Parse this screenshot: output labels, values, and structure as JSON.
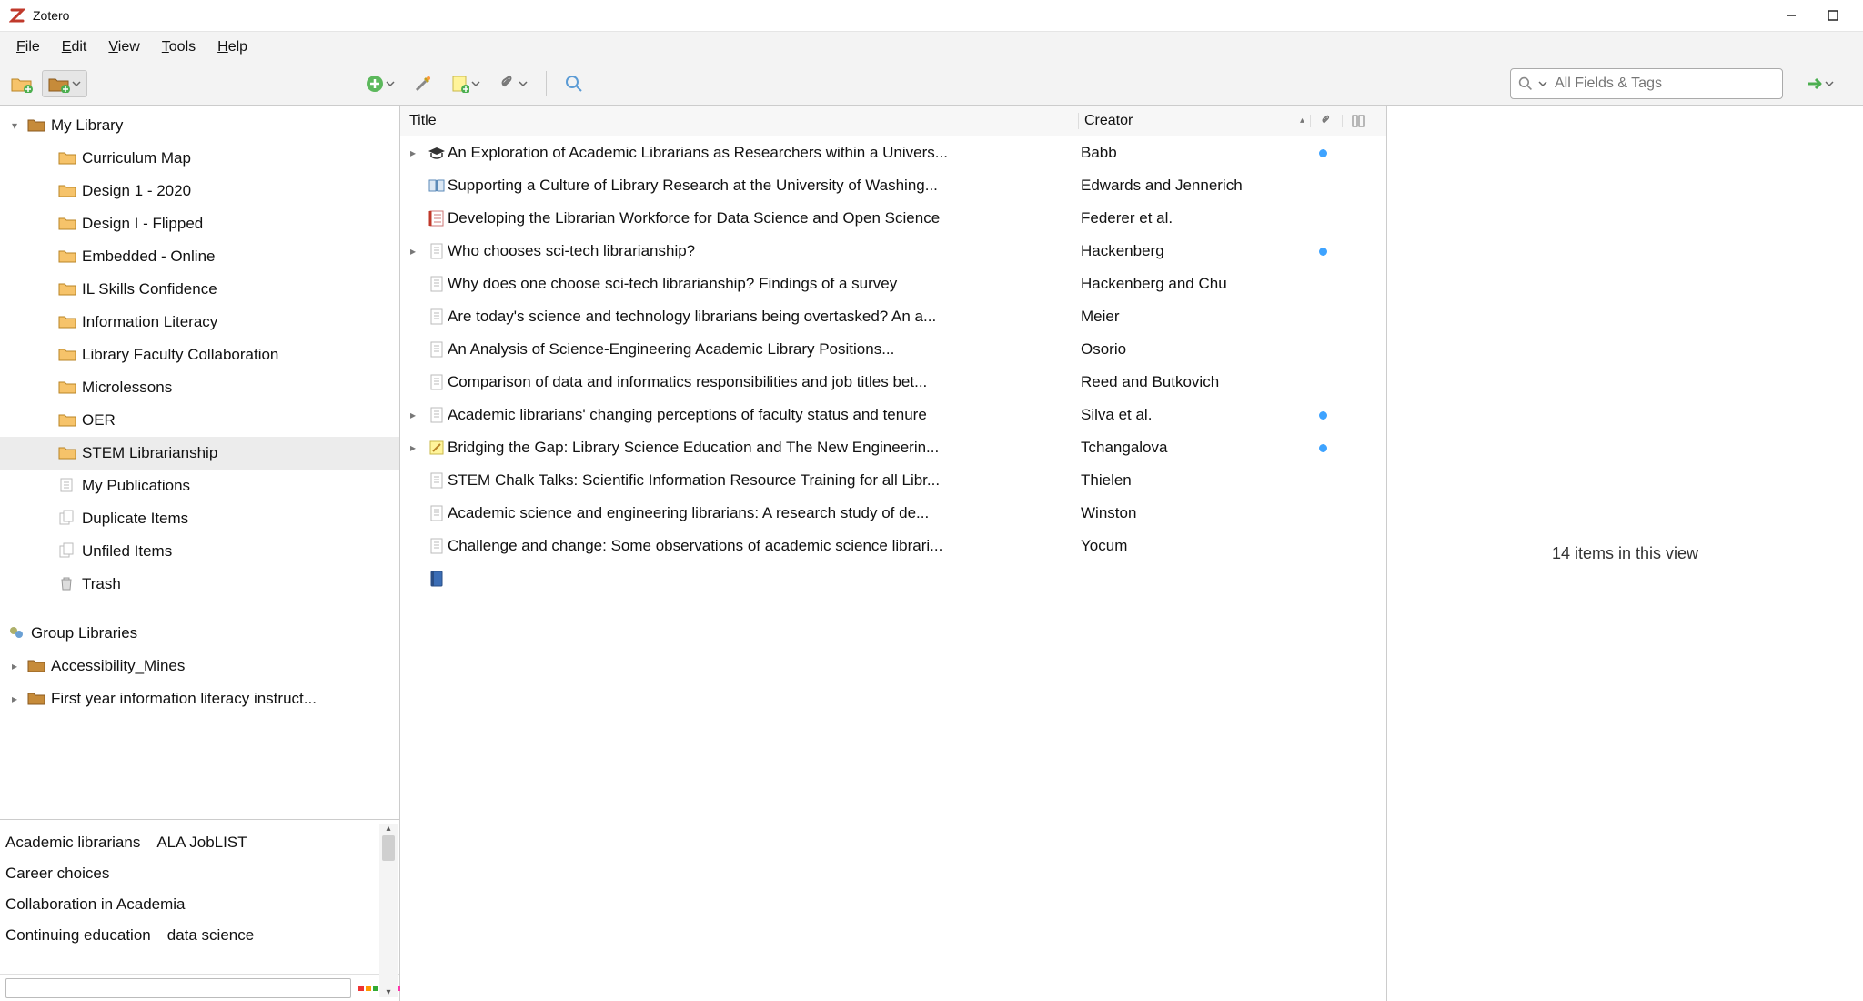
{
  "app": {
    "title": "Zotero"
  },
  "menu": {
    "file": "File",
    "edit": "Edit",
    "view": "View",
    "tools": "Tools",
    "help": "Help"
  },
  "search": {
    "placeholder": "All Fields & Tags"
  },
  "sidebar": {
    "my_library": "My Library",
    "collections": [
      "Curriculum Map",
      "Design 1 - 2020",
      "Design I - Flipped",
      "Embedded - Online",
      "IL Skills Confidence",
      "Information Literacy",
      "Library Faculty Collaboration",
      "Microlessons",
      "OER",
      "STEM Librarianship"
    ],
    "selected_index": 9,
    "my_publications": "My Publications",
    "duplicate": "Duplicate Items",
    "unfiled": "Unfiled Items",
    "trash": "Trash",
    "group_libraries": "Group Libraries",
    "groups": [
      "Accessibility_Mines",
      "First year information literacy instruct..."
    ]
  },
  "tags": [
    "Academic librarians",
    "ALA JobLIST",
    "Career choices",
    "Collaboration in Academia",
    "Continuing education",
    "data science"
  ],
  "columns": {
    "title": "Title",
    "creator": "Creator"
  },
  "items": [
    {
      "expand": true,
      "icon": "grad",
      "title": "An Exploration of Academic Librarians as Researchers within a Univers...",
      "creator": "Babb",
      "attach": true
    },
    {
      "expand": false,
      "icon": "book",
      "title": "Supporting a Culture of Library Research at the University of Washing...",
      "creator": "Edwards and Jennerich",
      "attach": false
    },
    {
      "expand": false,
      "icon": "list",
      "title": "Developing the Librarian Workforce for Data Science and Open Science",
      "creator": "Federer et al.",
      "attach": false
    },
    {
      "expand": true,
      "icon": "doc",
      "title": "Who chooses sci-tech librarianship?",
      "creator": "Hackenberg",
      "attach": true
    },
    {
      "expand": false,
      "icon": "doc",
      "title": "Why does one choose sci-tech librarianship? Findings of a survey",
      "creator": "Hackenberg and Chu",
      "attach": false
    },
    {
      "expand": false,
      "icon": "doc",
      "title": "Are today's science and technology librarians being overtasked? An a...",
      "creator": "Meier",
      "attach": false
    },
    {
      "expand": false,
      "icon": "doc",
      "title": "An Analysis of Science-Engineering Academic Library Positions...",
      "creator": "Osorio",
      "attach": false
    },
    {
      "expand": false,
      "icon": "doc",
      "title": "Comparison of data and informatics responsibilities and job titles bet...",
      "creator": "Reed and Butkovich",
      "attach": false
    },
    {
      "expand": true,
      "icon": "doc",
      "title": "Academic librarians' changing perceptions of faculty status and tenure",
      "creator": "Silva et al.",
      "attach": true
    },
    {
      "expand": true,
      "icon": "note",
      "title": "Bridging the Gap: Library Science Education and The New Engineerin...",
      "creator": "Tchangalova",
      "attach": true
    },
    {
      "expand": false,
      "icon": "doc",
      "title": "STEM Chalk Talks: Scientific Information Resource Training for all Libr...",
      "creator": "Thielen",
      "attach": false
    },
    {
      "expand": false,
      "icon": "doc",
      "title": "Academic science and engineering librarians: A research study of de...",
      "creator": "Winston",
      "attach": false
    },
    {
      "expand": false,
      "icon": "doc",
      "title": "Challenge and change: Some observations of academic science librari...",
      "creator": "Yocum",
      "attach": false
    },
    {
      "expand": false,
      "icon": "bluebook",
      "title": "",
      "creator": "",
      "attach": false
    }
  ],
  "details": {
    "status": "14 items in this view"
  }
}
